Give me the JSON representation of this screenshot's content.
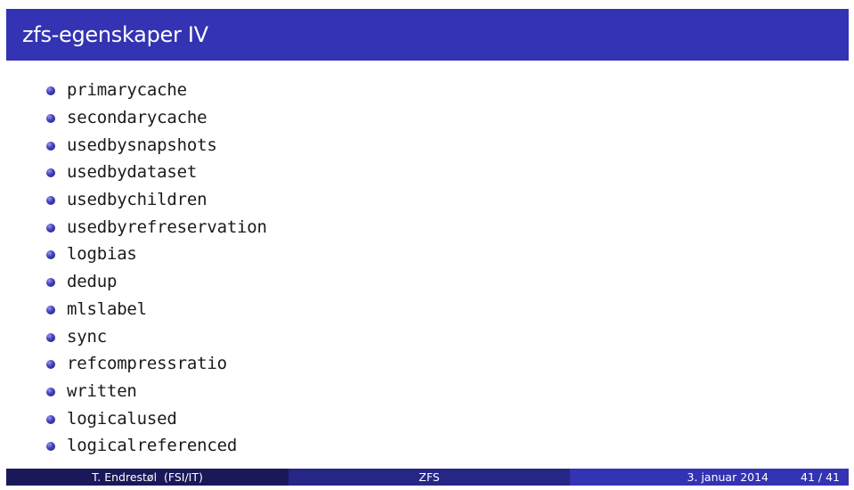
{
  "slide": {
    "title": "zfs-egenskaper IV",
    "items": [
      {
        "label": "primarycache"
      },
      {
        "label": "secondarycache"
      },
      {
        "label": "usedbysnapshots"
      },
      {
        "label": "usedbydataset"
      },
      {
        "label": "usedbychildren"
      },
      {
        "label": "usedbyrefreservation"
      },
      {
        "label": "logbias"
      },
      {
        "label": "dedup"
      },
      {
        "label": "mlslabel"
      },
      {
        "label": "sync"
      },
      {
        "label": "refcompressratio"
      },
      {
        "label": "written"
      },
      {
        "label": "logicalused"
      },
      {
        "label": "logicalreferenced"
      }
    ]
  },
  "footer": {
    "author": "T. Endrestøl  (FSI/IT)",
    "short_title": "ZFS",
    "date": "3. januar 2014",
    "page": "41 / 41"
  },
  "colors": {
    "title_bar": "#3333b3",
    "footer_dark": "#191959",
    "footer_mid": "#262686",
    "footer_light": "#3333b3"
  }
}
